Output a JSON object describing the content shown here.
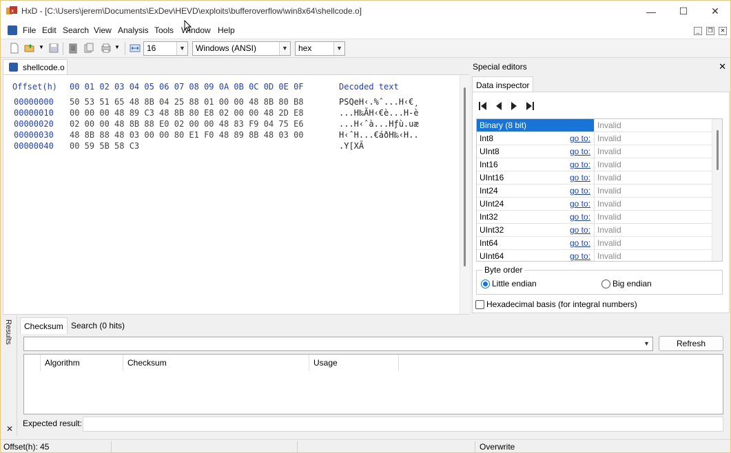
{
  "window": {
    "title": "HxD - [C:\\Users\\jerem\\Documents\\ExDev\\HEVD\\exploits\\bufferoverflow\\win8x64\\shellcode.o]",
    "minimize_glyph": "—",
    "maximize_glyph": "☐",
    "close_glyph": "✕"
  },
  "menu": {
    "items": [
      "File",
      "Edit",
      "Search",
      "View",
      "Analysis",
      "Tools",
      "Window",
      "Help"
    ],
    "mdi_minimize": "_",
    "mdi_restore": "❐",
    "mdi_close": "✕"
  },
  "toolbar": {
    "bytes_per_row": "16",
    "charset": "Windows (ANSI)",
    "offset_base": "hex",
    "icons": [
      "new-file-icon",
      "open-file-icon",
      "save-icon",
      "clipboard-icon",
      "copy-icon",
      "print-icon",
      "bytes-per-row-icon"
    ]
  },
  "document": {
    "tab_label": "shellcode.o",
    "header_offset": "Offset(h)",
    "header_bytes": "00 01 02 03 04 05 06 07 08 09 0A 0B 0C 0D 0E 0F",
    "header_decoded": "Decoded text",
    "rows": [
      {
        "offset": "00000000",
        "bytes": "50 53 51 65 48 8B 04 25 88 01 00 00 48 8B 80 B8",
        "decoded": "PSQeH‹.%ˆ...H‹€¸"
      },
      {
        "offset": "00000010",
        "bytes": "00 00 00 48 89 C3 48 8B 80 E8 02 00 00 48 2D E8",
        "decoded": "...H‰ÃH‹€è...H-è"
      },
      {
        "offset": "00000020",
        "bytes": "02 00 00 48 8B 88 E0 02 00 00 48 83 F9 04 75 E6",
        "decoded": "...H‹ˆà...Hƒù.uæ"
      },
      {
        "offset": "00000030",
        "bytes": "48 8B 88 48 03 00 00 80 E1 F0 48 89 8B 48 03 00",
        "decoded": "H‹ˆH...€áðH‰‹H.."
      },
      {
        "offset": "00000040",
        "bytes": "00 59 5B 58 C3",
        "decoded": ".Y[XÃ"
      }
    ]
  },
  "special_editors": {
    "title": "Special editors",
    "close_glyph": "✕",
    "tab_label": "Data inspector",
    "nav_icons": [
      "first-icon",
      "previous-icon",
      "next-icon",
      "last-icon"
    ],
    "goto_label": "go to:",
    "rows": [
      {
        "type": "Binary (8 bit)",
        "value": "Invalid",
        "selected": true,
        "goto": false
      },
      {
        "type": "Int8",
        "value": "Invalid",
        "goto": true
      },
      {
        "type": "UInt8",
        "value": "Invalid",
        "goto": true
      },
      {
        "type": "Int16",
        "value": "Invalid",
        "goto": true
      },
      {
        "type": "UInt16",
        "value": "Invalid",
        "goto": true
      },
      {
        "type": "Int24",
        "value": "Invalid",
        "goto": true
      },
      {
        "type": "UInt24",
        "value": "Invalid",
        "goto": true
      },
      {
        "type": "Int32",
        "value": "Invalid",
        "goto": true
      },
      {
        "type": "UInt32",
        "value": "Invalid",
        "goto": true
      },
      {
        "type": "Int64",
        "value": "Invalid",
        "goto": true
      },
      {
        "type": "UInt64",
        "value": "Invalid",
        "goto": true
      }
    ],
    "byte_order_label": "Byte order",
    "little_endian": "Little endian",
    "big_endian": "Big endian",
    "little_endian_selected": true,
    "hex_basis_label": "Hexadecimal basis (for integral numbers)",
    "hex_basis_checked": false
  },
  "results": {
    "side_label": "Results",
    "close_glyph": "✕",
    "tabs": [
      "Checksum",
      "Search (0 hits)"
    ],
    "refresh_label": "Refresh",
    "columns": [
      "Algorithm",
      "Checksum",
      "Usage"
    ],
    "expected_label": "Expected result:",
    "expected_value": ""
  },
  "statusbar": {
    "offset": "Offset(h): 45",
    "mode": "Overwrite"
  },
  "colors": {
    "accent": "#1874d6",
    "hex_blue": "#1f3fbf",
    "link": "#1a3fb8",
    "frame": "#e8c77a"
  }
}
